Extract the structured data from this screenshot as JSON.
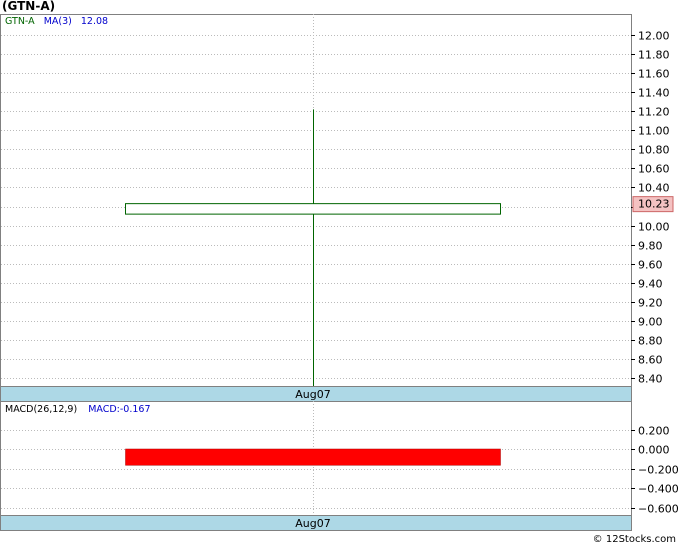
{
  "ticker_title": "(GTN-A)",
  "credit": "© 12Stocks.com",
  "colors": {
    "candle": "#006400",
    "macd_bar": "#ff0000",
    "axis_band": "#add8e6",
    "price_tag": "#f4c2c2",
    "grid": "#bbbbbb"
  },
  "chart_data": [
    {
      "type": "candlestick",
      "legend": {
        "symbol": "GTN-A",
        "ma_label": "MA(3)",
        "ma_value": "12.08"
      },
      "x_label": "Aug07",
      "y_ticks": [
        8.4,
        8.6,
        8.8,
        9.0,
        9.2,
        9.4,
        9.6,
        9.8,
        10.0,
        10.2,
        10.4,
        10.6,
        10.8,
        11.0,
        11.2,
        11.4,
        11.6,
        11.8,
        12.0
      ],
      "y_tick_labels": [
        "8.40",
        "8.60",
        "8.80",
        "9.00",
        "9.20",
        "9.40",
        "9.60",
        "9.80",
        "10.00",
        "10.20",
        "10.40",
        "10.60",
        "10.80",
        "11.00",
        "11.20",
        "11.40",
        "11.60",
        "11.80",
        "12.00"
      ],
      "ylim": [
        8.3,
        12.1
      ],
      "candles": [
        {
          "date": "Aug07",
          "open": 10.23,
          "high": 11.22,
          "low": 8.3,
          "close": 10.12
        }
      ],
      "last_price": 10.23,
      "last_price_label": "10.23",
      "grid": true
    },
    {
      "type": "bar",
      "legend": {
        "label": "MACD(26,12,9)",
        "value_label": "MACD:-0.167"
      },
      "x_label": "Aug07",
      "y_ticks": [
        0.2,
        0.0,
        -0.2,
        -0.4,
        -0.6
      ],
      "y_tick_labels": [
        "0.200",
        "0.000",
        "−0.200",
        "−0.400",
        "−0.600"
      ],
      "ylim": [
        -0.7,
        0.3
      ],
      "values": [
        -0.167
      ],
      "grid": true
    }
  ]
}
